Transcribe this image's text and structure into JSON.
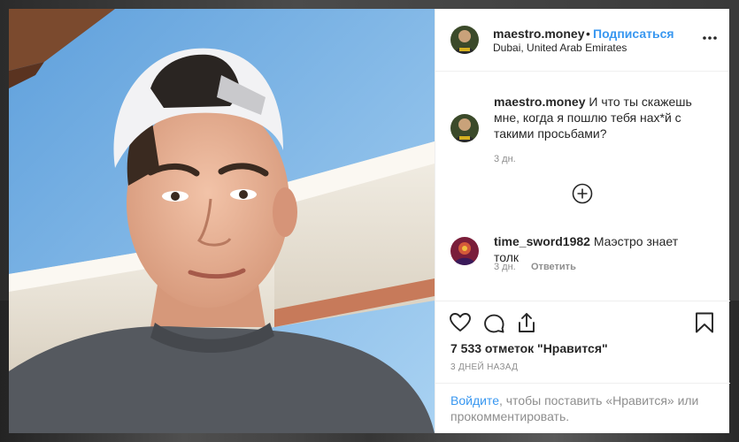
{
  "post": {
    "username": "maestro.money",
    "separator": "•",
    "follow_label": "Подписаться",
    "location": "Dubai, United Arab Emirates",
    "more_icon": "more-options-icon"
  },
  "comments": [
    {
      "username": "maestro.money",
      "text": "И что ты скажешь мне, когда я пошлю тебя нах*й с такими просьбами?",
      "time": "3 дн."
    },
    {
      "username": "time_sword1982",
      "text": "Маэстро знает толк",
      "time": "3 дн.",
      "reply_label": "Ответить"
    }
  ],
  "load_more_icon": "plus-circle-icon",
  "actions": {
    "like_icon": "heart-icon",
    "comment_icon": "comment-icon",
    "share_icon": "share-icon",
    "save_icon": "bookmark-icon"
  },
  "likes_text": "7 533 отметок \"Нравится\"",
  "posted_ago": "3 ДНЕЙ НАЗАД",
  "footer": {
    "login_label": "Войдите",
    "rest_text": ", чтобы поставить «Нравится» или прокомментировать."
  },
  "colors": {
    "accent": "#3897f0",
    "text": "#262626",
    "muted": "#8e8e8e"
  }
}
